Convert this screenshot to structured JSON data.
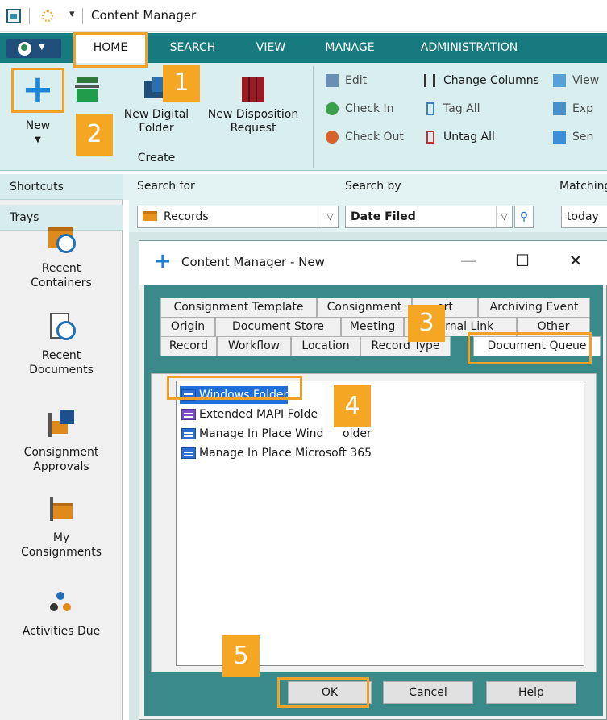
{
  "window": {
    "title": "Content Manager"
  },
  "ribbon_tabs": [
    "HOME",
    "SEARCH",
    "VIEW",
    "MANAGE",
    "ADMINISTRATION"
  ],
  "ribbon": {
    "new_label": "New",
    "new_digital_folder": [
      "New Digital",
      "Folder"
    ],
    "new_disposition_request": [
      "New Disposition",
      "Request"
    ],
    "group_label": "Create",
    "small_items": [
      "Edit",
      "Check In",
      "Check Out",
      "Change Columns",
      "Tag All",
      "Untag All",
      "View",
      "Exp",
      "Sen"
    ]
  },
  "search": {
    "search_for_label": "Search for",
    "search_by_label": "Search by",
    "matching_label": "Matching",
    "search_for_value": "Records",
    "search_by_value": "Date Filed",
    "matching_value": "today"
  },
  "leftpane": {
    "shortcuts": "Shortcuts",
    "trays": "Trays",
    "items": [
      {
        "lines": [
          "Recent",
          "Containers"
        ],
        "icon": "recent-containers-icon"
      },
      {
        "lines": [
          "Recent",
          "Documents"
        ],
        "icon": "recent-documents-icon"
      },
      {
        "lines": [
          "Consignment",
          "Approvals"
        ],
        "icon": "consignment-approvals-icon"
      },
      {
        "lines": [
          "My",
          "Consignments"
        ],
        "icon": "my-consignments-icon"
      },
      {
        "lines": [
          "Activities Due"
        ],
        "icon": "activities-due-icon"
      }
    ]
  },
  "dialog": {
    "title": "Content Manager - New",
    "tab_rows": [
      [
        "Consignment Template",
        "Consignment",
        "ort",
        "Archiving Event"
      ],
      [
        "Origin",
        "Document Store",
        "Meeting",
        "xternal Link",
        "Other"
      ],
      [
        "Record",
        "Workflow",
        "Location",
        "Record Type",
        "Document Queue"
      ]
    ],
    "selected_tab": "Document Queue",
    "list_items": [
      "Windows Folder",
      "Extended MAPI Folde",
      "Manage In Place Wind",
      "older",
      "Manage In Place Microsoft 365"
    ],
    "buttons": {
      "ok": "OK",
      "cancel": "Cancel",
      "help": "Help"
    }
  },
  "callouts": [
    "1",
    "2",
    "3",
    "4",
    "5"
  ],
  "colors": {
    "accent_teal": "#177a7f",
    "callout_orange": "#f5a623",
    "selection_blue": "#1e6fd9"
  }
}
